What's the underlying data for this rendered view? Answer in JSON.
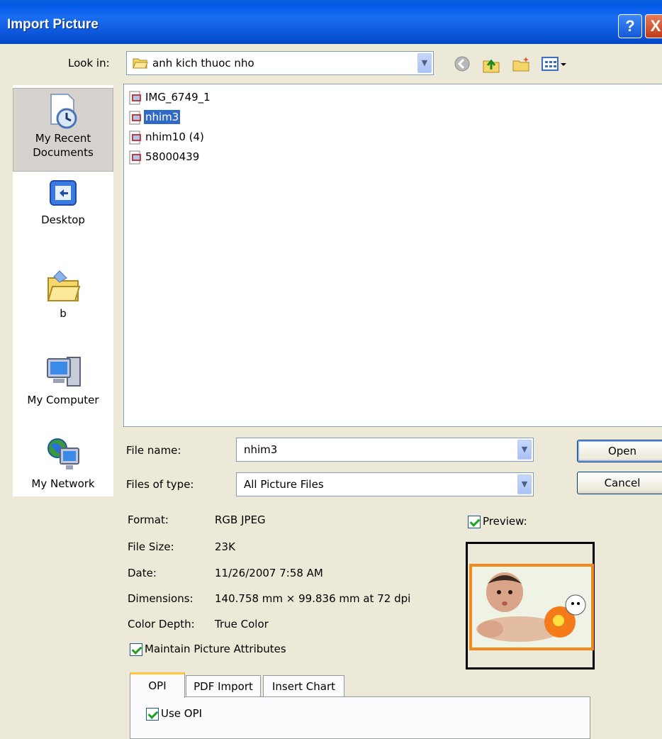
{
  "window": {
    "title": "Import Picture",
    "help_glyph": "?",
    "close_glyph": "X"
  },
  "lookin": {
    "label": "Look in:",
    "value": "anh kich thuoc nho"
  },
  "places": [
    {
      "label": "My Recent Documents",
      "line1": "My Recent",
      "line2": "Documents",
      "icon": "recent-documents-icon",
      "selected": true
    },
    {
      "label": "Desktop",
      "icon": "desktop-icon"
    },
    {
      "label": "b",
      "icon": "folder-icon"
    },
    {
      "label": "My Computer",
      "icon": "my-computer-icon"
    },
    {
      "label": "My Network",
      "icon": "my-network-icon"
    }
  ],
  "files": [
    {
      "name": "IMG_6749_1",
      "selected": false
    },
    {
      "name": "nhim3",
      "selected": true
    },
    {
      "name": "nhim10 (4)",
      "selected": false
    },
    {
      "name": "58000439",
      "selected": false
    }
  ],
  "filename": {
    "label": "File name:",
    "value": "nhim3"
  },
  "filetype": {
    "label": "Files of type:",
    "value": "All Picture Files"
  },
  "buttons": {
    "open": "Open",
    "cancel": "Cancel"
  },
  "info": {
    "format_label": "Format:",
    "format_value": "RGB JPEG",
    "size_label": "File Size:",
    "size_value": "23K",
    "date_label": "Date:",
    "date_value": "11/26/2007 7:58 AM",
    "dim_label": "Dimensions:",
    "dim_value": "140.758 mm × 99.836 mm at 72 dpi",
    "depth_label": "Color Depth:",
    "depth_value": "True Color"
  },
  "maintain": {
    "label": "Maintain Picture Attributes",
    "checked": true
  },
  "preview": {
    "label": "Preview:",
    "checked": true
  },
  "tabs": [
    {
      "label": "OPI",
      "active": true
    },
    {
      "label": "PDF Import"
    },
    {
      "label": "Insert Chart"
    }
  ],
  "opi": {
    "label": "Use OPI",
    "checked": true
  }
}
